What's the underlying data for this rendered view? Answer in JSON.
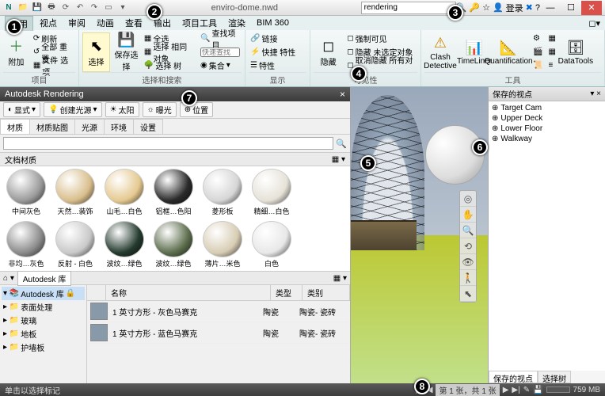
{
  "titlebar": {
    "filename": "enviro-dome.nwd",
    "search_value": "rendering",
    "login": "登录"
  },
  "menu": {
    "tabs": [
      "常用",
      "视点",
      "审阅",
      "动画",
      "查看",
      "输出",
      "项目工具",
      "渲染",
      "BIM 360"
    ],
    "active": 0
  },
  "ribbon": {
    "panels": {
      "project": {
        "title": "项目",
        "append": "附加",
        "refresh": "刷新",
        "reset": "全部 重置…",
        "file_opts": "文件 选项"
      },
      "select": {
        "title": "选择和搜索",
        "select": "选择",
        "save_sel": "保存选择",
        "select_all": "全选",
        "same": "选择 相同对象",
        "tree": "选择 树",
        "set": "集合",
        "find": "查找项目",
        "quick": "快速查找"
      },
      "display": {
        "title": "显示",
        "require": "强制可见",
        "hide": "隐藏",
        "hide_unsel": "隐藏 未选定对象",
        "unhide": "取消隐藏 所有对象",
        "links": "链接",
        "quickp": "快捷 特性",
        "props": "特性"
      },
      "vis": {
        "title": "可见性"
      },
      "tools": {
        "title": "工具",
        "clash": "Clash Detective",
        "tl": "TimeLiner",
        "quant": "Quantification",
        "dt": "DataTools"
      }
    }
  },
  "render_panel": {
    "title": "Autodesk Rendering",
    "toolbar": {
      "display": "显式",
      "create_light": "创建光源",
      "sun": "太阳",
      "exposure": "曝光",
      "position": "位置"
    },
    "tabs": [
      "材质",
      "材质贴图",
      "光源",
      "环境",
      "设置"
    ],
    "section_doc": "文档材质",
    "materials_row1": [
      {
        "name": "中间灰色",
        "c": "#9a9a9a"
      },
      {
        "name": "天然…装饰",
        "c": "#d9be8c"
      },
      {
        "name": "山毛…白色",
        "c": "#e5c990"
      },
      {
        "name": "铝框…色阳",
        "c": "#2a2a2a"
      },
      {
        "name": "菱形板",
        "c": "#d6d6d6"
      },
      {
        "name": "精细…白色",
        "c": "#e6e2d8"
      }
    ],
    "materials_row2": [
      {
        "name": "非均…灰色",
        "c": "#8a8a8a"
      },
      {
        "name": "反射 - 白色",
        "c": "#c9c9c9"
      },
      {
        "name": "波纹…绿色",
        "c": "#243a2e"
      },
      {
        "name": "波纹…绿色",
        "c": "#5c6d4c"
      },
      {
        "name": "薄片…米色",
        "c": "#d8cdb4"
      },
      {
        "name": "白色",
        "c": "#e8e8e8"
      }
    ],
    "library": {
      "breadcrumb": "Autodesk 库",
      "tree": [
        "Autodesk 库",
        "表面处理",
        "玻璃",
        "地板",
        "护墙板"
      ],
      "columns": [
        "名称",
        "类型",
        "类别"
      ],
      "rows": [
        {
          "name": "1 英寸方形 - 灰色马赛克",
          "type": "陶瓷",
          "cat": "陶瓷- 瓷砖"
        },
        {
          "name": "1 英寸方形 - 蓝色马赛克",
          "type": "陶瓷",
          "cat": "陶瓷- 瓷砖"
        }
      ]
    }
  },
  "viewpoints": {
    "title": "保存的视点",
    "items": [
      "Target Cam",
      "Upper Deck",
      "Lower Floor",
      "Walkway"
    ],
    "tabs": [
      "保存的视点",
      "选择树"
    ]
  },
  "statusbar": {
    "hint": "单击以选择标记",
    "sheet": "第 1 张，共 1 张",
    "mem": "759 MB"
  },
  "callouts": [
    "1",
    "2",
    "3",
    "4",
    "5",
    "6",
    "7",
    "8"
  ]
}
